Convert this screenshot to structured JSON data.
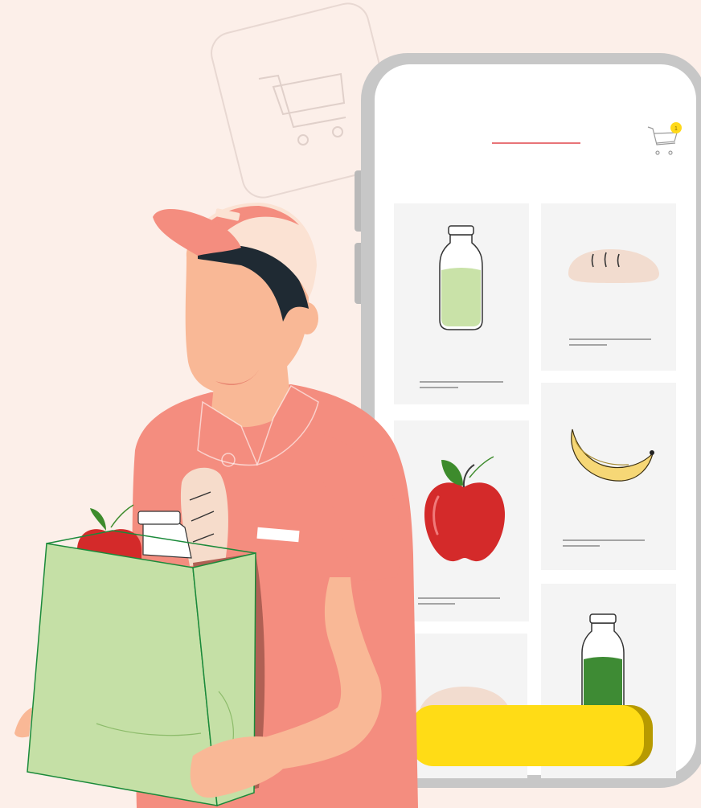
{
  "illustration": {
    "subject": "grocery-delivery-app",
    "icons": [
      "shopping-cart-icon",
      "milk-bottle-icon",
      "bread-icon",
      "apple-icon",
      "banana-icon",
      "juice-bottle-icon"
    ]
  },
  "app": {
    "cart_badge": "1"
  },
  "colors": {
    "background": "#fcefe9",
    "phone_frame": "#c7c7c7",
    "screen": "#ffffff",
    "card": "#f4f4f4",
    "accent_line": "#e0474c",
    "badge": "#ffd91a",
    "cta_button": "#ffdc16",
    "shirt": "#f48d7f",
    "bag": "#c5e0a6"
  }
}
